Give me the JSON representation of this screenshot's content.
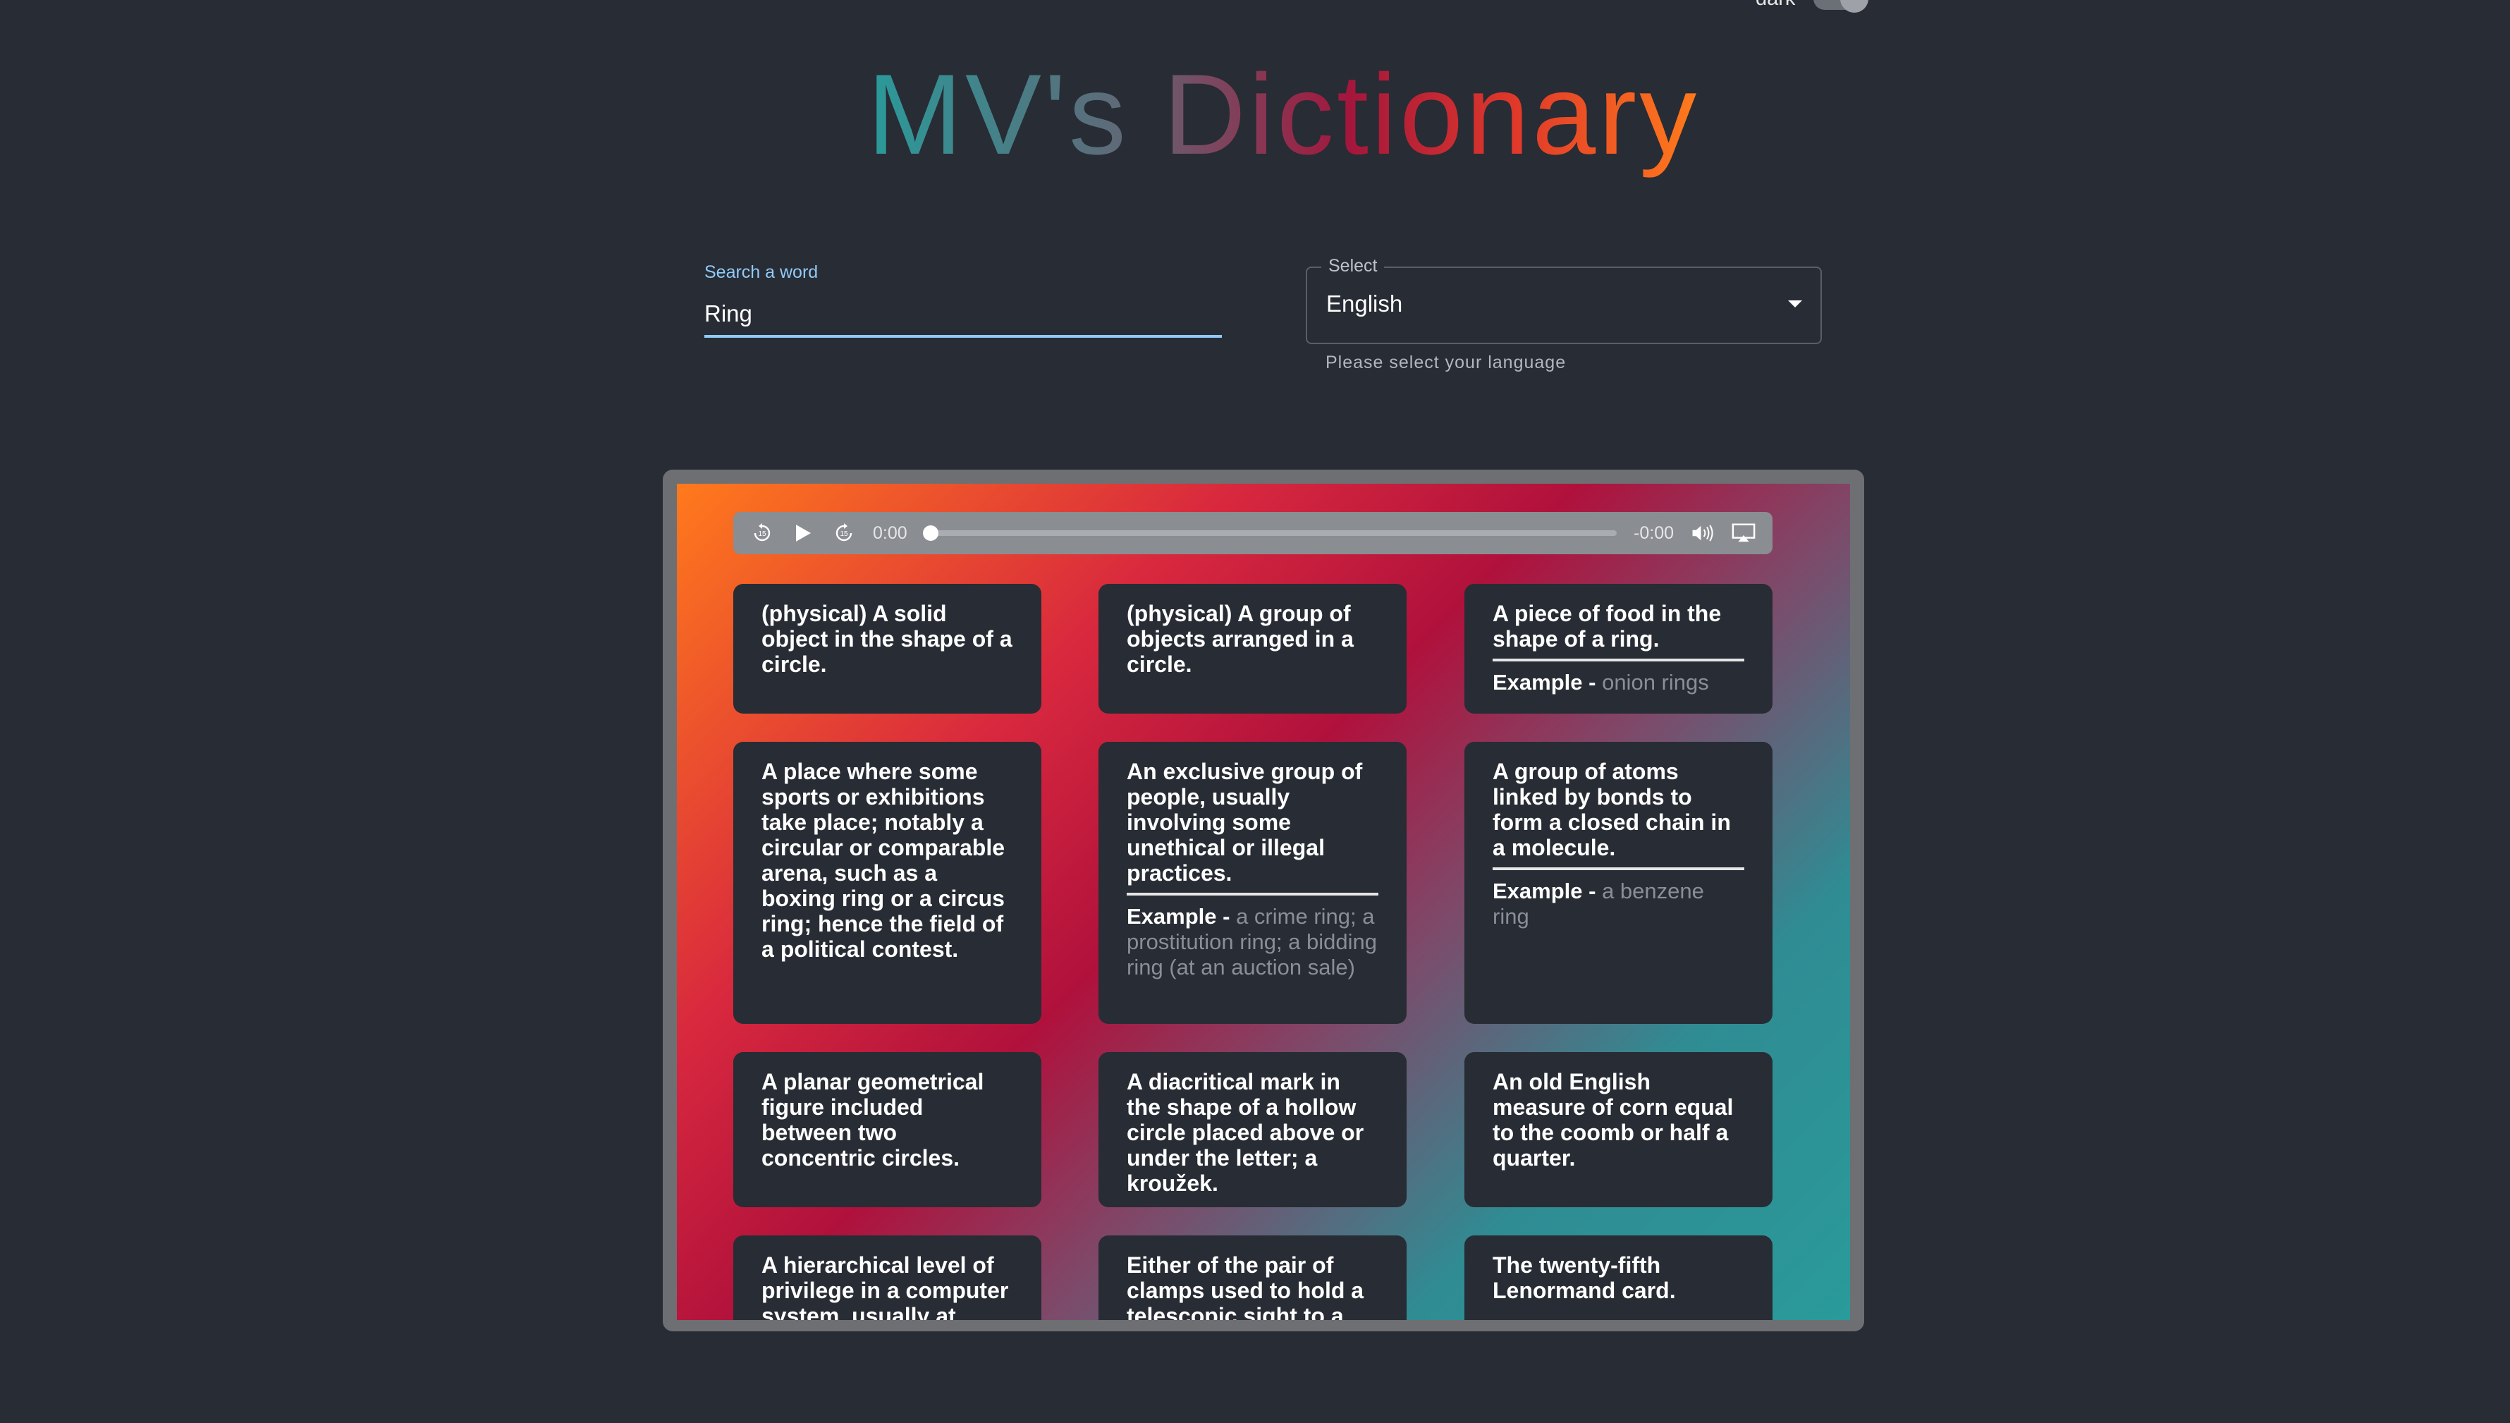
{
  "theme_toggle": {
    "label": "dark"
  },
  "title": "MV's Dictionary",
  "search": {
    "label": "Search a word",
    "value": "Ring"
  },
  "language_select": {
    "legend": "Select",
    "value": "English",
    "helper": "Please select your language"
  },
  "audio_player": {
    "current_time": "0:00",
    "remaining_time": "-0:00",
    "progress": 0
  },
  "definitions": [
    {
      "text": "(physical) A solid object in the shape of a circle."
    },
    {
      "text": "(physical) A group of objects arranged in a circle."
    },
    {
      "text": "A piece of food in the shape of a ring.",
      "example_label": "Example -",
      "example": "onion rings"
    },
    {
      "text": "A place where some sports or exhibitions take place; notably a circular or comparable arena, such as a boxing ring or a circus ring; hence the field of a political contest."
    },
    {
      "text": "An exclusive group of people, usually involving some unethical or illegal practices.",
      "example_label": "Example -",
      "example": "a crime ring; a prostitution ring; a bidding ring (at an auction sale)"
    },
    {
      "text": "A group of atoms linked by bonds to form a closed chain in a molecule.",
      "example_label": "Example -",
      "example": "a benzene ring"
    },
    {
      "text": "A planar geometrical figure included between two concentric circles."
    },
    {
      "text": "A diacritical mark in the shape of a hollow circle placed above or under the letter; a kroužek."
    },
    {
      "text": "An old English measure of corn equal to the coomb or half a quarter."
    },
    {
      "text": "A hierarchical level of privilege in a computer system, usually at"
    },
    {
      "text": "Either of the pair of clamps used to hold a telescopic sight to a"
    },
    {
      "text": "The twenty-fifth Lenormand card."
    }
  ]
}
